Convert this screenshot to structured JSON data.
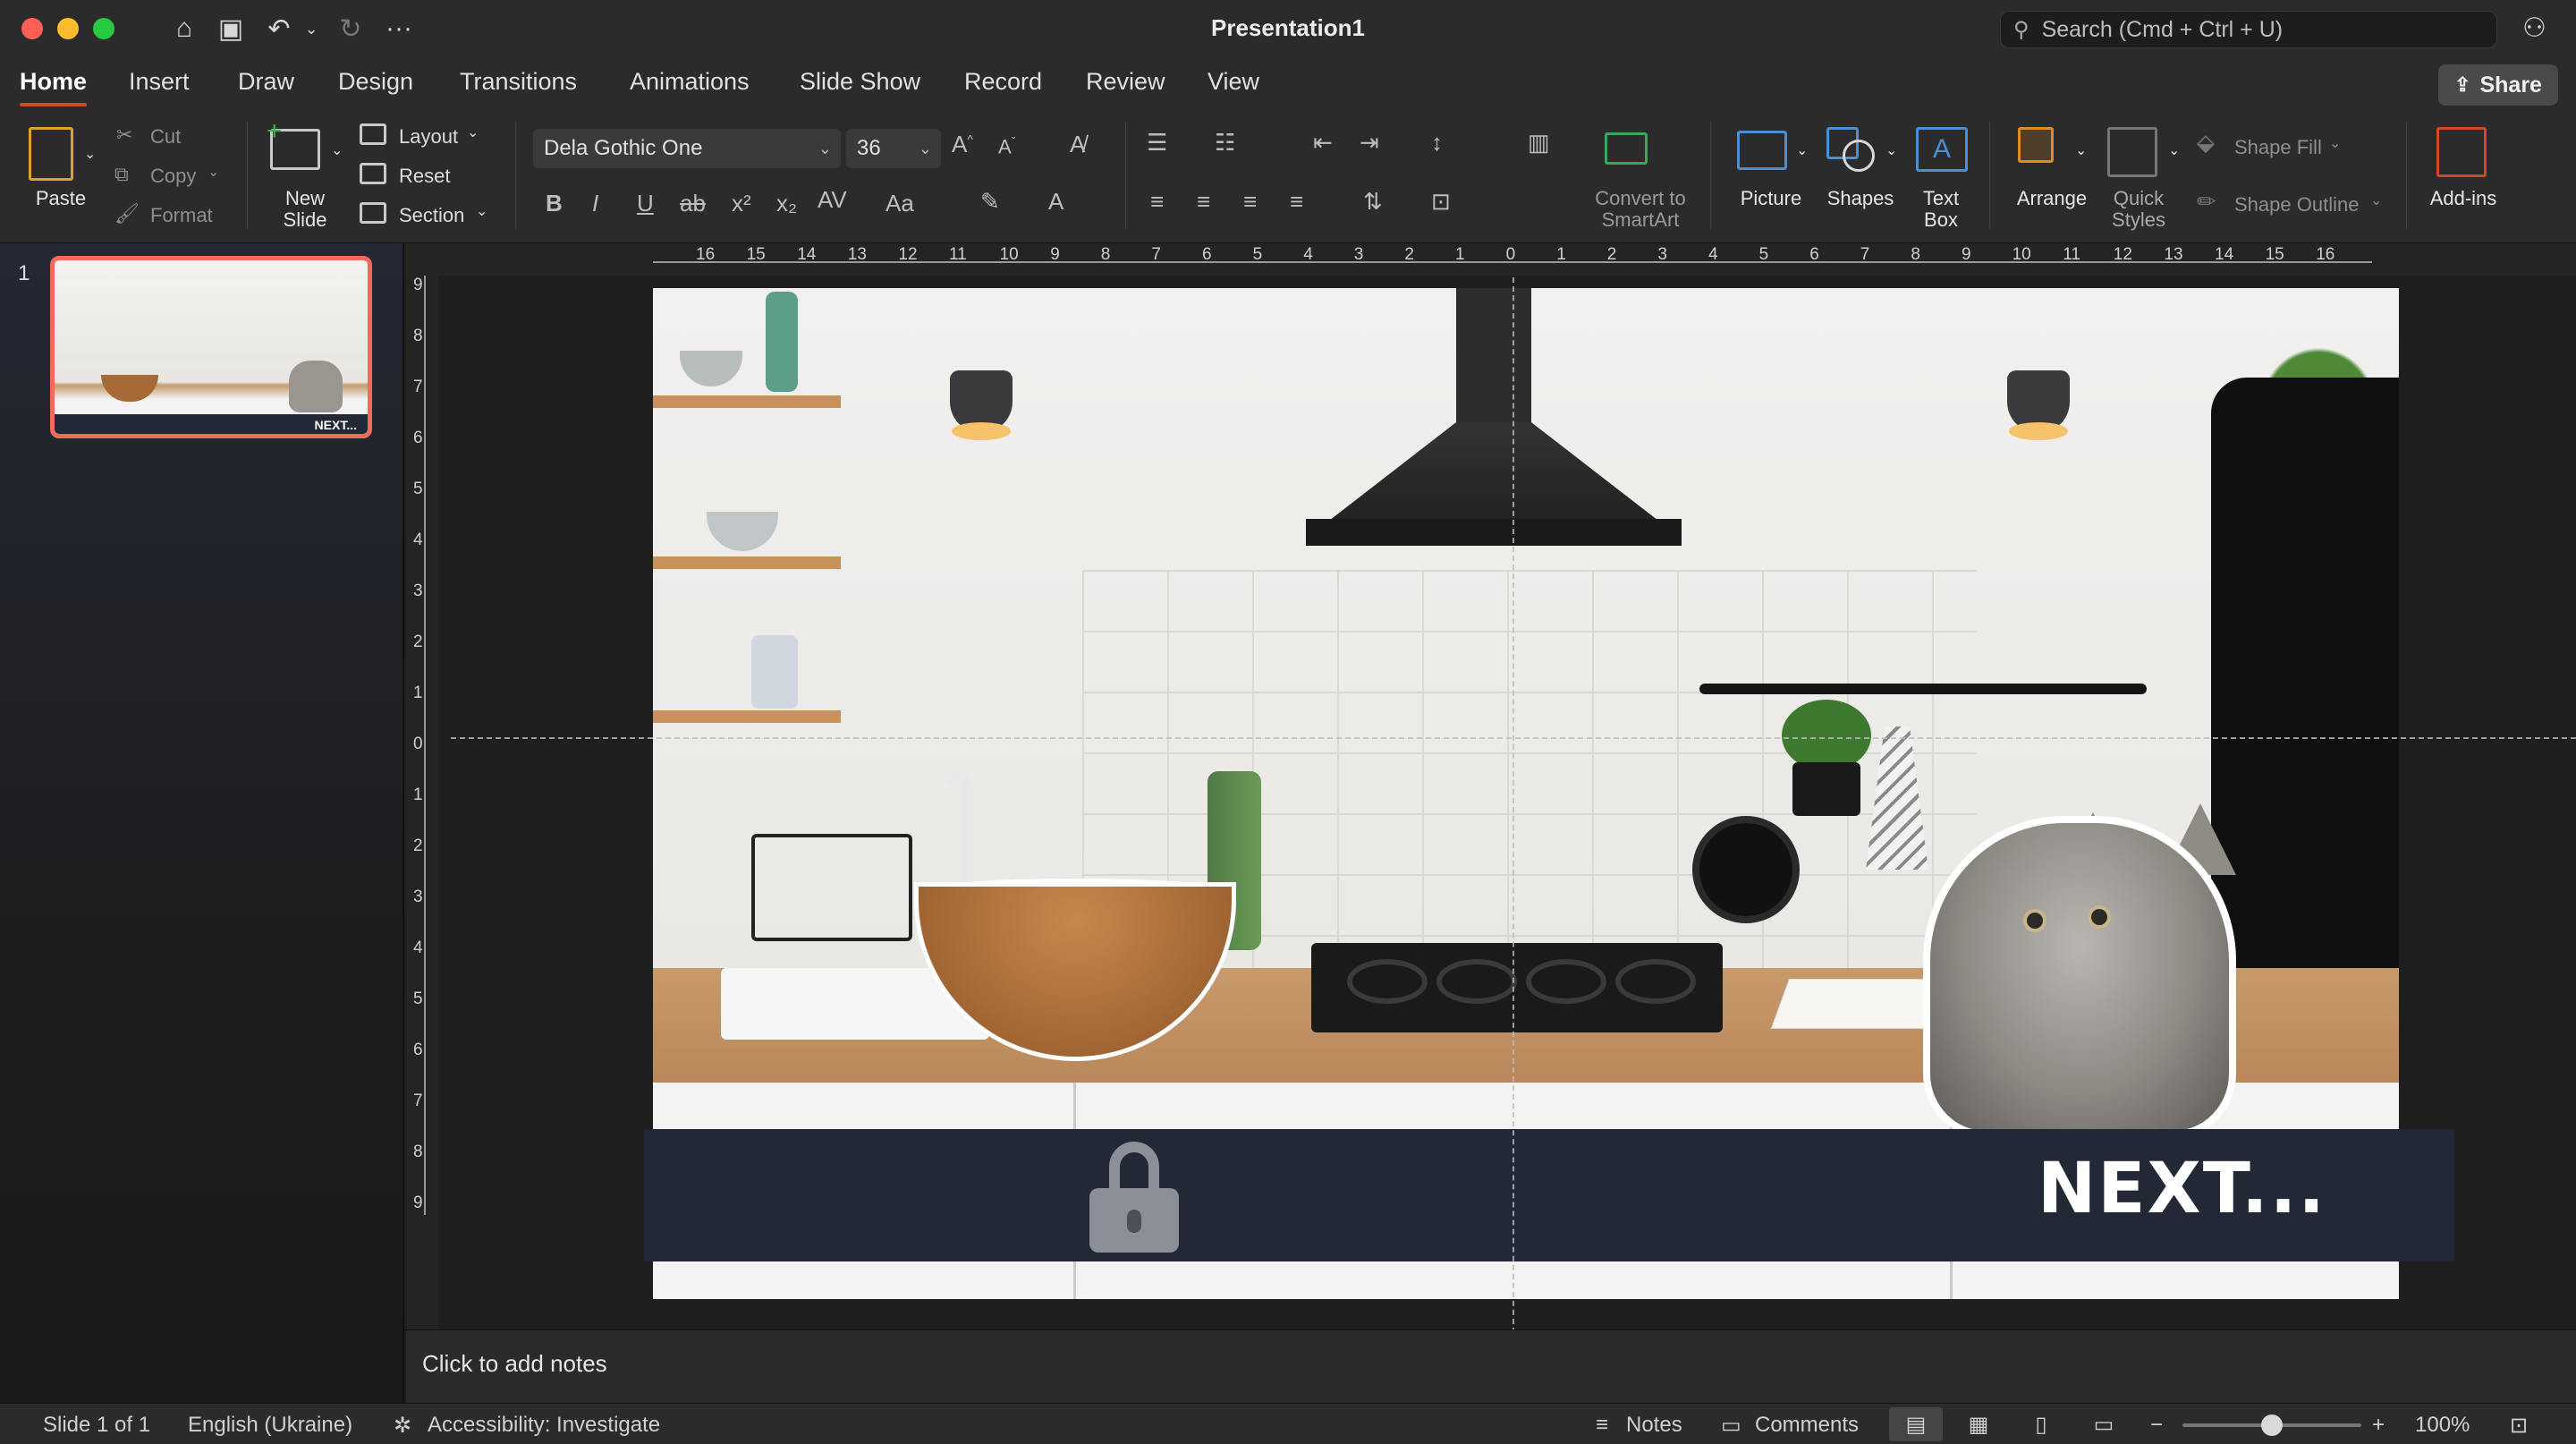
{
  "window": {
    "title": "Presentation1"
  },
  "search": {
    "placeholder": "Search (Cmd + Ctrl + U)"
  },
  "tabs": [
    "Home",
    "Insert",
    "Draw",
    "Design",
    "Transitions",
    "Animations",
    "Slide Show",
    "Record",
    "Review",
    "View"
  ],
  "share_label": "Share",
  "ribbon": {
    "paste": "Paste",
    "cut": "Cut",
    "copy": "Copy",
    "format": "Format",
    "new_slide": [
      "New",
      "Slide"
    ],
    "layout": "Layout",
    "reset": "Reset",
    "section": "Section",
    "font_name": "Dela Gothic One",
    "font_size": "36",
    "convert_smartart": [
      "Convert to",
      "SmartArt"
    ],
    "picture": "Picture",
    "shapes": "Shapes",
    "text_box": [
      "Text",
      "Box"
    ],
    "arrange": "Arrange",
    "quick_styles": [
      "Quick",
      "Styles"
    ],
    "shape_fill": "Shape Fill",
    "shape_outline": "Shape Outline",
    "add_ins": "Add-ins"
  },
  "thumbnails": [
    {
      "number": "1",
      "caption": "NEXT..."
    }
  ],
  "slide": {
    "next_text": "NEXT..."
  },
  "notes_placeholder": "Click to add notes",
  "status": {
    "slide_count": "Slide 1 of 1",
    "language": "English (Ukraine)",
    "accessibility": "Accessibility: Investigate",
    "notes": "Notes",
    "comments": "Comments",
    "zoom": "100%",
    "zoom_level": 0.5
  },
  "ruler_h": [
    "16",
    "15",
    "14",
    "13",
    "12",
    "11",
    "10",
    "9",
    "8",
    "7",
    "6",
    "5",
    "4",
    "3",
    "2",
    "1",
    "0",
    "1",
    "2",
    "3",
    "4",
    "5",
    "6",
    "7",
    "8",
    "9",
    "10",
    "11",
    "12",
    "13",
    "14",
    "15",
    "16"
  ],
  "ruler_v": [
    "9",
    "8",
    "7",
    "6",
    "5",
    "4",
    "3",
    "2",
    "1",
    "0",
    "1",
    "2",
    "3",
    "4",
    "5",
    "6",
    "7",
    "8",
    "9"
  ],
  "colors": {
    "accent": "#d24726",
    "thumb_border": "#f16a5b",
    "banner": "#232836"
  }
}
